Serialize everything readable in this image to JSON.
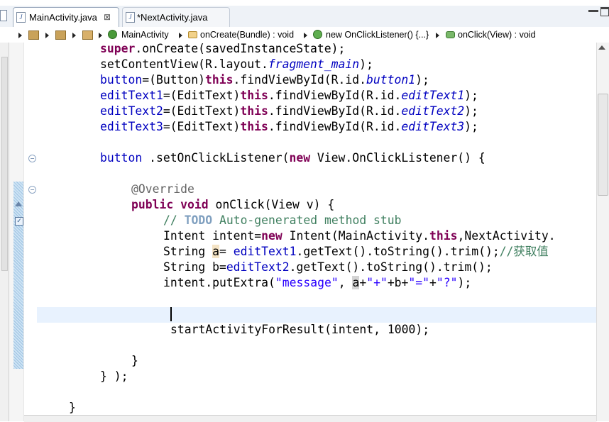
{
  "tabs": [
    {
      "label": "MainActivity.java",
      "close": "⊠",
      "active": true
    },
    {
      "label": "*NextActivity.java",
      "active": false
    }
  ],
  "breadcrumb": [
    {
      "label": "MainActivity"
    },
    {
      "label": "onCreate(Bundle) : void"
    },
    {
      "label": "new OnClickListener() {...}"
    },
    {
      "label": "onClick(View) : void"
    }
  ],
  "code": {
    "l1": {
      "a": "super",
      "b": ".onCreate(savedInstanceState);"
    },
    "l2": {
      "a": "setContentView(R.layout.",
      "b": "fragment_main",
      "c": ");"
    },
    "l3": {
      "a": "button",
      "b": "=(Button)",
      "c": "this",
      "d": ".findViewById(R.id.",
      "e": "button1",
      "f": ");"
    },
    "l4": {
      "a": "editText1",
      "b": "=(EditText)",
      "c": "this",
      "d": ".findViewById(R.id.",
      "e": "editText1",
      "f": ");"
    },
    "l5": {
      "a": "editText2",
      "b": "=(EditText)",
      "c": "this",
      "d": ".findViewById(R.id.",
      "e": "editText2",
      "f": ");"
    },
    "l6": {
      "a": "editText3",
      "b": "=(EditText)",
      "c": "this",
      "d": ".findViewById(R.id.",
      "e": "editText3",
      "f": ");"
    },
    "l7": {
      "a": "button",
      "b": " .setOnClickListener(",
      "c": "new",
      "d": " View.OnClickListener() {"
    },
    "l8": {
      "a": "@Override"
    },
    "l9": {
      "a": "public",
      "b": " ",
      "c": "void",
      "d": " onClick(View v) {"
    },
    "l10": {
      "a": "// ",
      "b": "TODO",
      "c": " Auto-generated method stub"
    },
    "l11": {
      "a": "Intent intent=",
      "b": "new",
      "c": " Intent(MainActivity.",
      "d": "this",
      "e": ",NextActivity."
    },
    "l12": {
      "a": "String ",
      "b": "a",
      "c": "= ",
      "d": "editText1",
      "e": ".getText().toString().trim();",
      "f": "//获取值"
    },
    "l13": {
      "a": "String b=",
      "b": "editText2",
      "c": ".getText().toString().trim();"
    },
    "l14": {
      "a": "intent.putExtra(",
      "b": "\"message\"",
      "c": ", ",
      "d": "a",
      "e": "+",
      "f": "\"+\"",
      "g": "+b+",
      "h": "\"=\"",
      "i": "+",
      "j": "\"?\"",
      "k": ");"
    },
    "l15": {
      "a": "startActivityForResult(intent, 1000);"
    },
    "l16": {
      "a": "}"
    },
    "l17": {
      "a": "} );"
    },
    "l18": {
      "a": "}"
    }
  },
  "colors": {
    "keyword": "#7f0055",
    "field": "#0000c0",
    "string": "#2a00ff",
    "comment": "#3f7f5f",
    "current_line": "#e8f2fe"
  }
}
